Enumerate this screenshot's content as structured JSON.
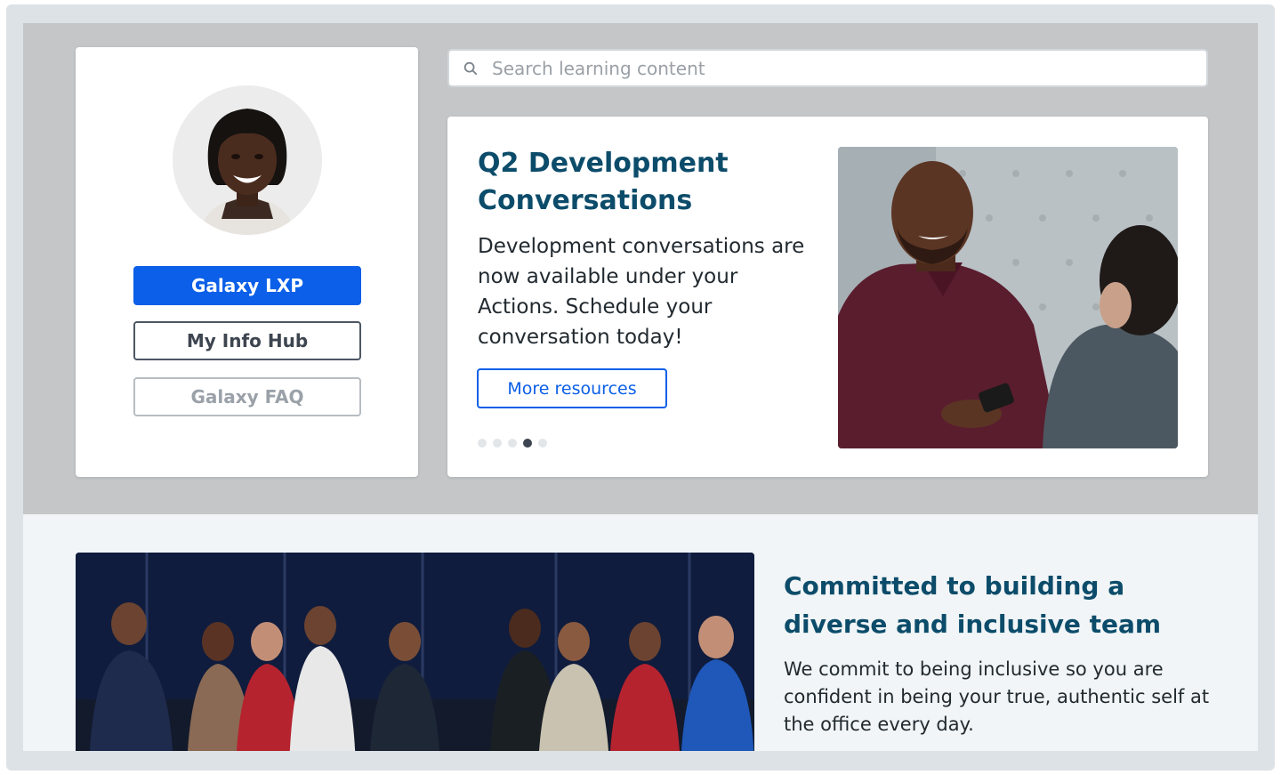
{
  "profile": {
    "avatar_icon": "user-avatar-photo",
    "buttons": {
      "primary": "Galaxy LXP",
      "secondary": "My Info Hub",
      "disabled": "Galaxy FAQ"
    }
  },
  "search": {
    "icon": "search-icon",
    "placeholder": "Search learning content",
    "value": ""
  },
  "feature": {
    "title": "Q2 Development Conversations",
    "body": "Development conversations are now available under your Actions. Schedule your conversation today!",
    "cta": "More resources",
    "carousel": {
      "count": 5,
      "active_index": 3
    }
  },
  "team": {
    "title": "Committed to building a diverse and inclusive team",
    "body": "We commit to being inclusive so you are confident in being your true, authentic self at the office every day."
  },
  "colors": {
    "accent": "#0b5fe8",
    "heading": "#0c4c6a",
    "band": "#c4c6c7"
  }
}
